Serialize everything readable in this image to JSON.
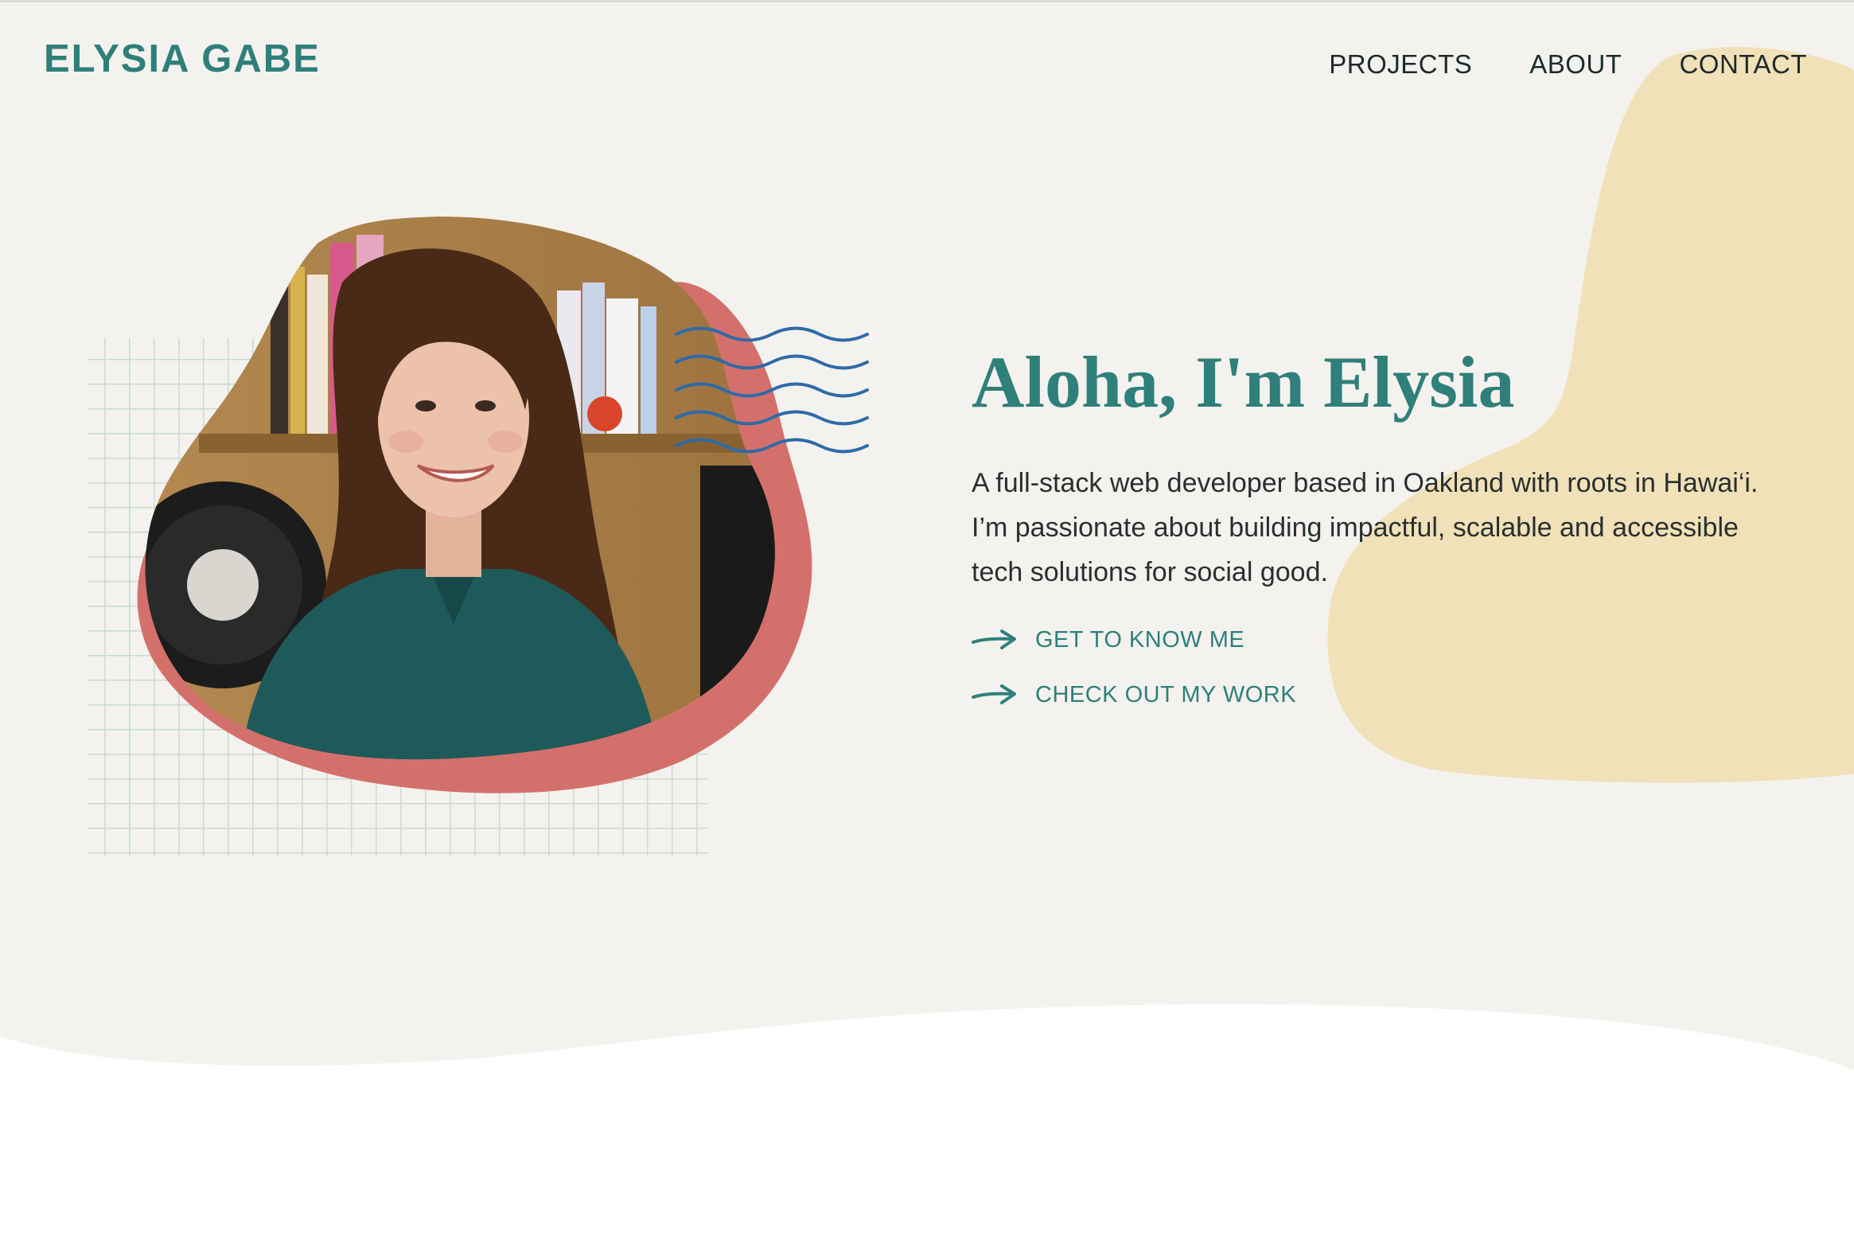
{
  "header": {
    "logo_text": "ELYSIA GABE",
    "nav": [
      {
        "label": "PROJECTS"
      },
      {
        "label": "ABOUT"
      },
      {
        "label": "CONTACT"
      }
    ]
  },
  "hero": {
    "title": "Aloha, I'm Elysia",
    "description": "A full-stack web developer based in Oakland with roots in Hawai‘i. I’m passionate about building impactful, scalable and accessible tech solutions for social good.",
    "ctas": [
      {
        "label": "GET TO KNOW ME",
        "icon": "arrow-right-icon"
      },
      {
        "label": "CHECK OUT MY WORK",
        "icon": "arrow-right-icon"
      }
    ],
    "photo_alt": "portrait photo"
  },
  "colors": {
    "accent_teal": "#2f7f7a",
    "background_cream": "#f4f2ee",
    "blob_yellow": "#f0e1b8",
    "blob_coral": "#d4706b",
    "wave_blue": "#2f6aa8",
    "grid_green": "#c8dbd3"
  }
}
